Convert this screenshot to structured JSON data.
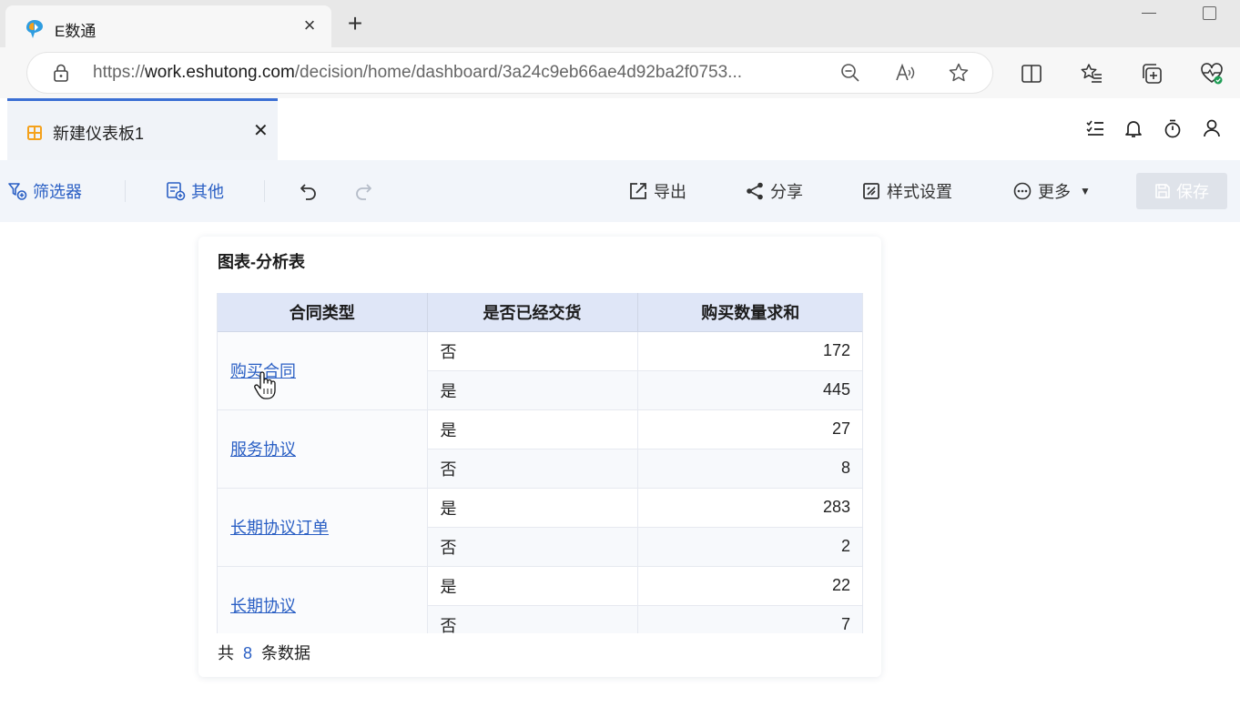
{
  "browser": {
    "tab_title": "E数通",
    "url_prefix": "https://",
    "url_host": "work.eshutong.com",
    "url_path": "/decision/home/dashboard/3a24c9eb66ae4d92ba2f0753..."
  },
  "app": {
    "tab_title": "新建仪表板1",
    "toolbar": {
      "filter": "筛选器",
      "other": "其他",
      "export": "导出",
      "share": "分享",
      "style": "样式设置",
      "more": "更多",
      "save": "保存"
    }
  },
  "widget": {
    "title": "图表-分析表",
    "columns": [
      "合同类型",
      "是否已经交货",
      "购买数量求和"
    ],
    "groups": [
      {
        "name": "购买合同",
        "rows": [
          {
            "delivered": "否",
            "sum": "172"
          },
          {
            "delivered": "是",
            "sum": "445"
          }
        ]
      },
      {
        "name": "服务协议",
        "rows": [
          {
            "delivered": "是",
            "sum": "27"
          },
          {
            "delivered": "否",
            "sum": "8"
          }
        ]
      },
      {
        "name": "长期协议订单",
        "rows": [
          {
            "delivered": "是",
            "sum": "283"
          },
          {
            "delivered": "否",
            "sum": "2"
          }
        ]
      },
      {
        "name": "长期协议",
        "rows": [
          {
            "delivered": "是",
            "sum": "22"
          },
          {
            "delivered": "否",
            "sum": "7"
          }
        ]
      }
    ],
    "footer": {
      "prefix": "共",
      "count": "8",
      "suffix": "条数据"
    }
  },
  "colors": {
    "accent": "#2a5fc4",
    "header_bg": "#dfe6f7",
    "toolbar_bg": "#f2f5fa"
  }
}
